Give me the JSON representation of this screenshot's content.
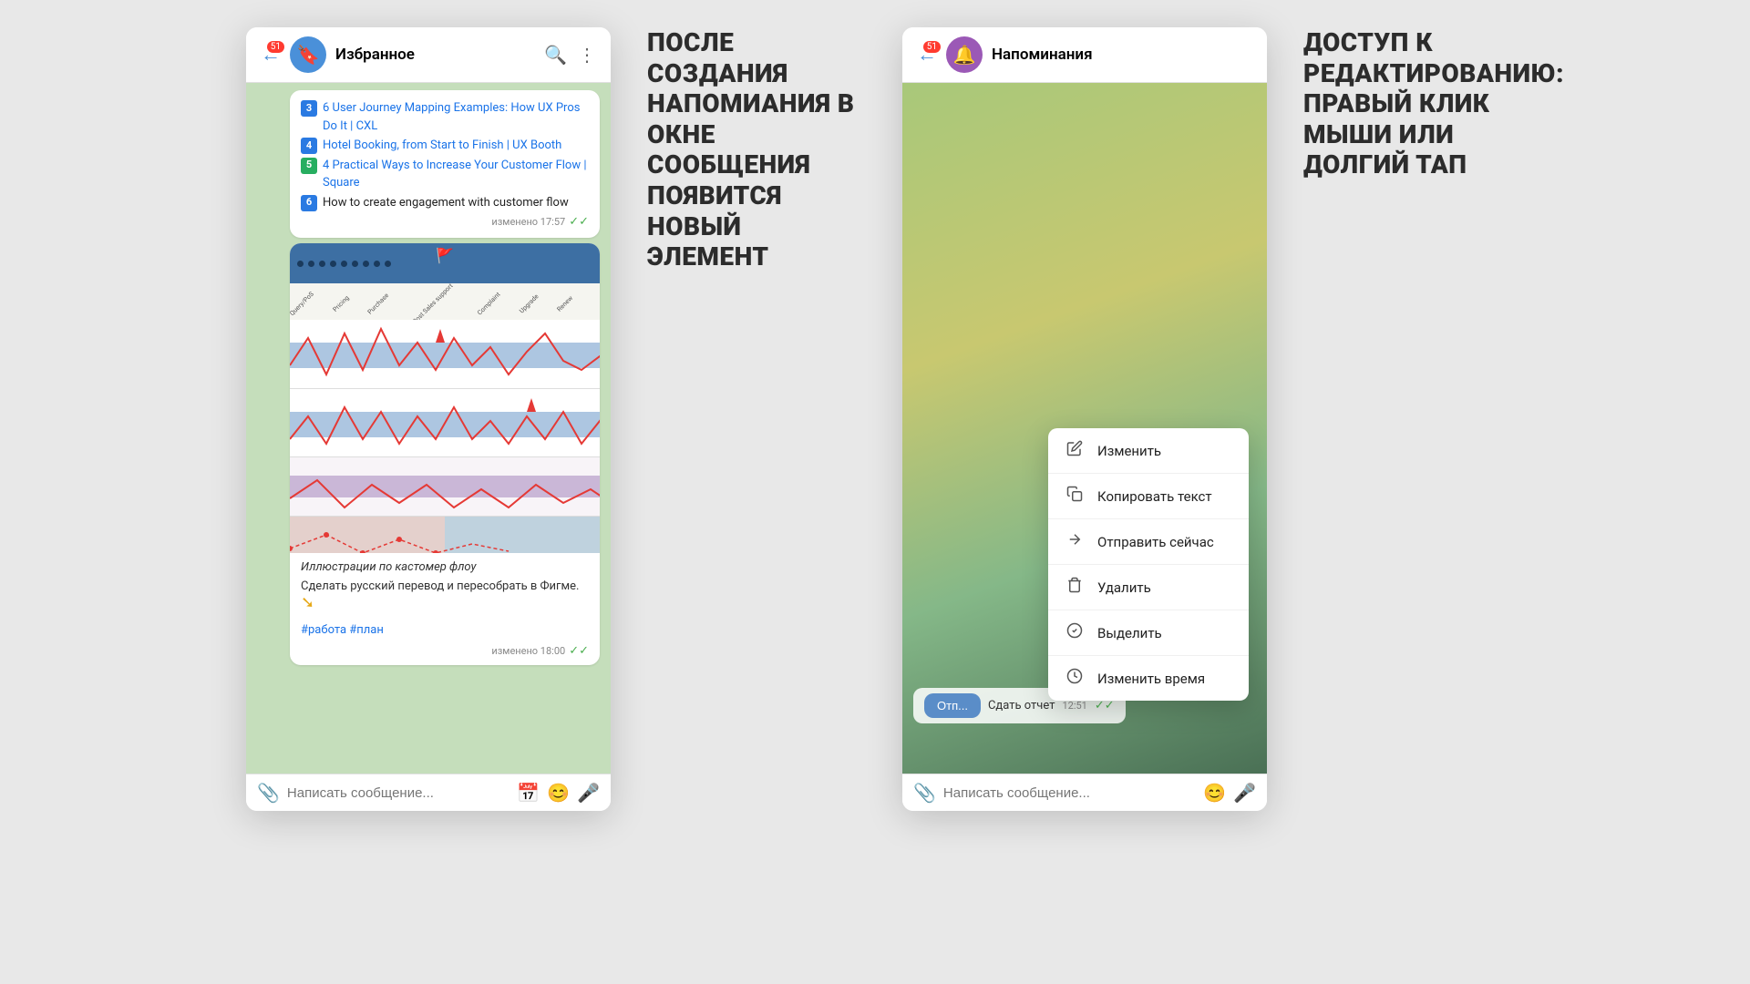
{
  "left_window": {
    "title": "Избранное",
    "badge": "51",
    "back_icon": "←",
    "avatar_icon": "🔖",
    "search_icon": "🔍",
    "menu_icon": "⋮",
    "messages": [
      {
        "type": "links",
        "items": [
          {
            "num": "3",
            "color": "blue",
            "text": "6 User Journey Mapping Examples: How UX Pros Do It | CXL"
          },
          {
            "num": "4",
            "color": "blue",
            "text": "Hotel Booking, from Start to Finish | UX Booth"
          },
          {
            "num": "5",
            "color": "green",
            "text": "4 Practical Ways to Increase Your Customer Flow | Square"
          },
          {
            "num": "6",
            "color": "blue",
            "text": "How to create engagement with customer flow"
          }
        ],
        "time": "изменено 17:57",
        "checkmarks": "✓✓"
      },
      {
        "type": "image",
        "caption": "Иллюстрации по кастомер флоу",
        "subcaption": "Сделать русский перевод и пересобрать в Фигме.",
        "hashtags": "#работа #план",
        "time": "изменено 18:00",
        "checkmarks": "✓✓"
      }
    ],
    "input_placeholder": "Написать сообщение...",
    "input_icons": [
      "📎",
      "📅",
      "😊",
      "🎤"
    ]
  },
  "middle_annotation": {
    "text": "ПОСЛЕ СОЗДАНИЯ НАПОМИАНИЯ В ОКНЕ СООБЩЕНИЯ ПОЯВИТСЯ НОВЫЙ ЭЛЕМЕНТ"
  },
  "right_window": {
    "title": "Напоминания",
    "badge": "51",
    "back_icon": "←",
    "avatar_icon": "🔔",
    "context_menu": {
      "items": [
        {
          "icon": "✏️",
          "label": "Изменить"
        },
        {
          "icon": "📋",
          "label": "Копировать текст"
        },
        {
          "icon": "➤",
          "label": "Отправить сейчас"
        },
        {
          "icon": "🗑",
          "label": "Удалить"
        },
        {
          "icon": "✅",
          "label": "Выделить"
        },
        {
          "icon": "⏱",
          "label": "Изменить время"
        }
      ]
    },
    "report_button": "Сдать отчет",
    "time": "12:51",
    "checkmarks": "✓✓",
    "input_placeholder": "Написать сообщение...",
    "ot_button": "Отп..."
  },
  "right_annotation": {
    "text": "ДОСТУП К РЕДАКТИРОВАНИЮ: ПРАВЫЙ КЛИК МЫШИ ИЛИ ДОЛГИЙ ТАП"
  }
}
